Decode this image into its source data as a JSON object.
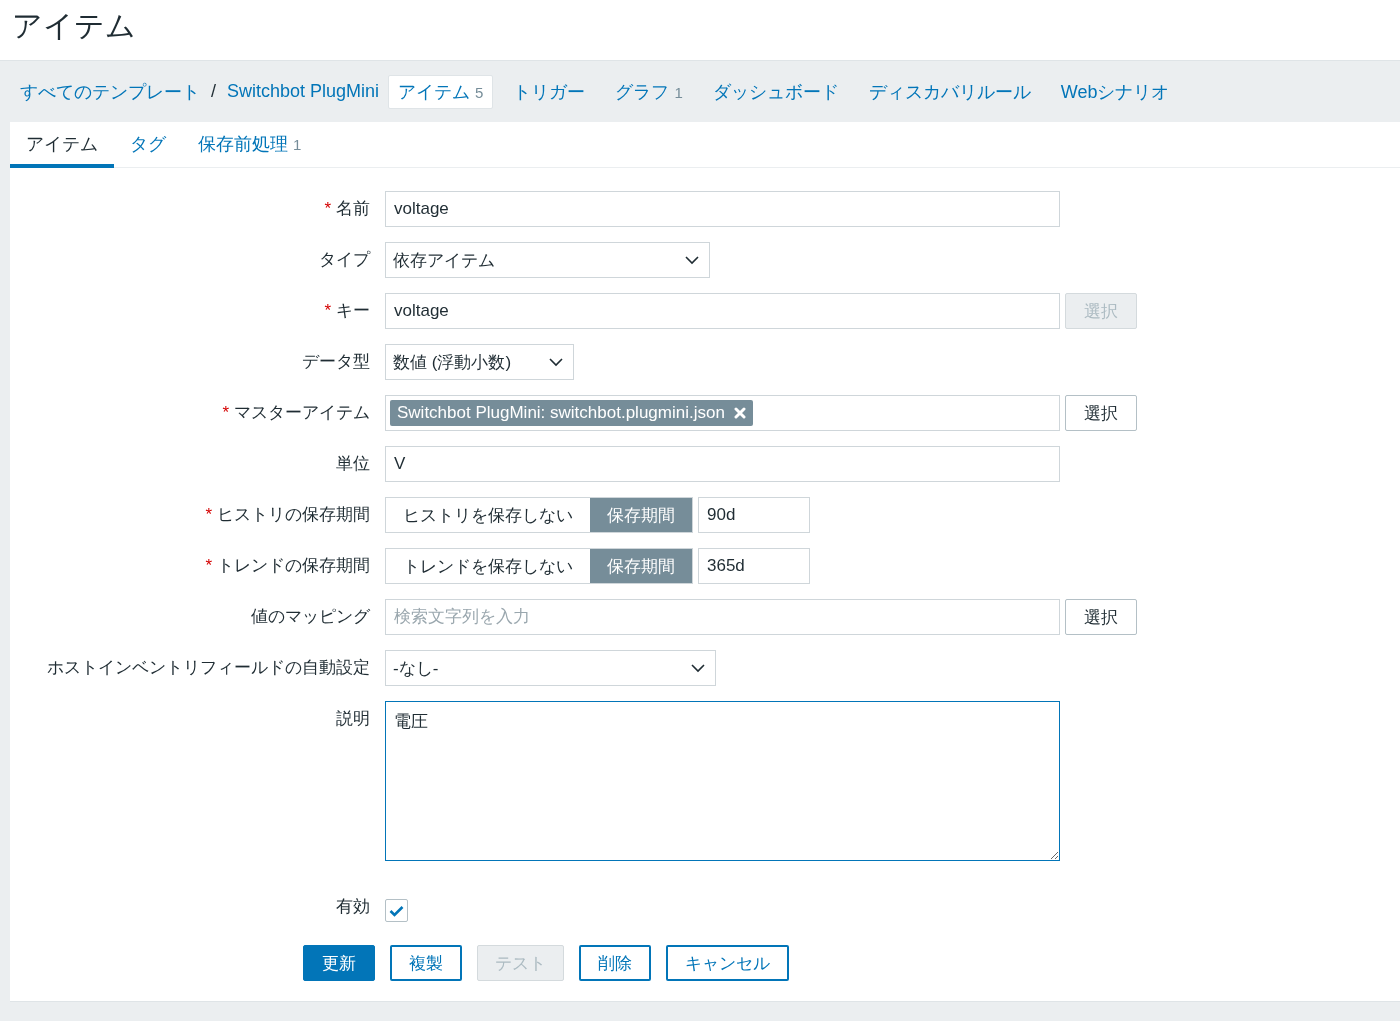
{
  "page_title": "アイテム",
  "breadcrumb": [
    {
      "label": "すべてのテンプレート"
    },
    {
      "label": "Switchbot PlugMini"
    }
  ],
  "breadcrumb_separator": "/",
  "nav_tabs": [
    {
      "label": "アイテム",
      "count": "5",
      "selected": true
    },
    {
      "label": "トリガー",
      "selected": false
    },
    {
      "label": "グラフ",
      "count": "1",
      "selected": false
    },
    {
      "label": "ダッシュボード",
      "selected": false
    },
    {
      "label": "ディスカバリルール",
      "selected": false
    },
    {
      "label": "Webシナリオ",
      "selected": false
    }
  ],
  "form_tabs": [
    {
      "label": "アイテム",
      "selected": true
    },
    {
      "label": "タグ",
      "selected": false
    },
    {
      "label": "保存前処理",
      "count": "1",
      "selected": false
    }
  ],
  "fields": [
    {
      "kind": "text",
      "label": "名前",
      "required_mark": "*",
      "value": "voltage"
    },
    {
      "kind": "select",
      "label": "タイプ",
      "value": "依存アイテム"
    },
    {
      "kind": "text_button",
      "label": "キー",
      "required_mark": "*",
      "value": "voltage",
      "button": "選択",
      "button_disabled": true
    },
    {
      "kind": "select",
      "label": "データ型",
      "value": "数値 (浮動小数)"
    },
    {
      "kind": "multiselect",
      "label": "マスターアイテム",
      "required_mark": "*",
      "chip": "Switchbot PlugMini: switchbot.plugmini.json",
      "button": "選択",
      "button_disabled": false
    },
    {
      "kind": "text",
      "label": "単位",
      "value": "V"
    },
    {
      "kind": "retention",
      "label": "ヒストリの保存期間",
      "required_mark": "*",
      "options": [
        {
          "label": "ヒストリを保存しない",
          "selected": false
        },
        {
          "label": "保存期間",
          "selected": true
        }
      ],
      "value": "90d"
    },
    {
      "kind": "retention",
      "label": "トレンドの保存期間",
      "required_mark": "*",
      "options": [
        {
          "label": "トレンドを保存しない",
          "selected": false
        },
        {
          "label": "保存期間",
          "selected": true
        }
      ],
      "value": "365d"
    },
    {
      "kind": "text_button",
      "label": "値のマッピング",
      "placeholder": "検索文字列を入力",
      "button": "選択",
      "button_disabled": false
    },
    {
      "kind": "select",
      "label": "ホストインベントリフィールドの自動設定",
      "value": "-なし-"
    },
    {
      "kind": "textarea",
      "label": "説明",
      "value": "電圧",
      "focused": true
    },
    {
      "kind": "checkbox",
      "label": "有効",
      "checked": true
    }
  ],
  "buttons": [
    {
      "label": "更新",
      "kind": "primary",
      "disabled": false
    },
    {
      "label": "複製",
      "kind": "secondary",
      "disabled": false
    },
    {
      "label": "テスト",
      "kind": "secondary",
      "disabled": true
    },
    {
      "label": "削除",
      "kind": "secondary",
      "disabled": false
    },
    {
      "label": "キャンセル",
      "kind": "secondary",
      "disabled": false
    }
  ]
}
